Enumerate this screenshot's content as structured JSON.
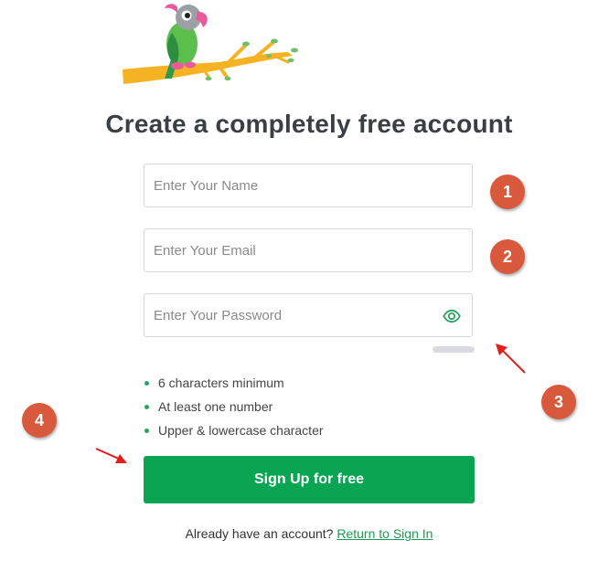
{
  "page": {
    "title": "Create a completely free account"
  },
  "form": {
    "name_placeholder": "Enter Your Name",
    "email_placeholder": "Enter Your Email",
    "password_placeholder": "Enter Your Password",
    "requirements": [
      "6 characters minimum",
      "At least one number",
      "Upper & lowercase character"
    ],
    "signup_label": "Sign Up for free"
  },
  "footer": {
    "text": "Already have an account?",
    "link": "Return to Sign In"
  },
  "annotations": {
    "badges": [
      "1",
      "2",
      "3",
      "4"
    ]
  },
  "icons": {
    "logo": "parrot-on-branch-logo",
    "password_toggle": "eye-icon",
    "arrows": "red-arrow-icon"
  },
  "colors": {
    "primary": "#0aa553",
    "link": "#1e9a52",
    "badge": "#d9593c",
    "arrow": "#e01f1f",
    "bullet": "#27a55b"
  }
}
